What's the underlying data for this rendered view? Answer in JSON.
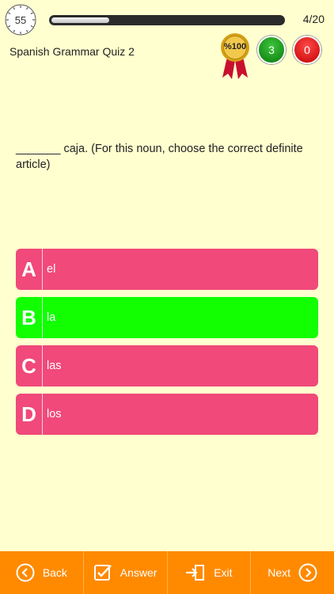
{
  "timer": {
    "value": "55"
  },
  "progress": {
    "current": "4/20",
    "fraction": 0.25
  },
  "quiz": {
    "title": "Spanish Grammar Quiz 2"
  },
  "medal": {
    "label": "%100"
  },
  "scores": {
    "correct": "3",
    "wrong": "0"
  },
  "question": {
    "text": "_______ caja. (For this noun, choose the correct definite article)"
  },
  "options": [
    {
      "letter": "A",
      "text": "el",
      "color": "#f0497a"
    },
    {
      "letter": "B",
      "text": "la",
      "color": "#11ff00"
    },
    {
      "letter": "C",
      "text": "las",
      "color": "#f0497a"
    },
    {
      "letter": "D",
      "text": "los",
      "color": "#f0497a"
    }
  ],
  "toolbar": {
    "back": "Back",
    "answer": "Answer",
    "exit": "Exit",
    "next": "Next"
  },
  "colors": {
    "background": "#ffffcf",
    "bar": "#ff8a00"
  }
}
